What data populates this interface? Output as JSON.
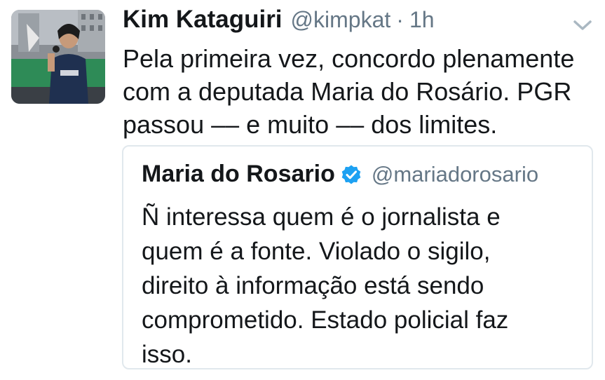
{
  "tweet": {
    "author_name": "Kim Kataguiri",
    "author_handle": "@kimpkat",
    "separator": "·",
    "time": "1h",
    "avatar_icon": "profile-photo",
    "menu_icon": "chevron-down-icon",
    "text_lines": [
      "Pela primeira vez, concordo plenamente",
      "com a deputada Maria do Rosário. PGR",
      "passou –– e muito –– dos limites."
    ]
  },
  "quoted_tweet": {
    "author_name": "Maria do Rosario",
    "verified_icon": "verified-badge-icon",
    "author_handle": "@mariadorosario",
    "text_lines": [
      "Ñ interessa quem é o jornalista e",
      "quem é a fonte. Violado o sigilo,",
      "direito à informação está sendo",
      "comprometido. Estado policial faz",
      "isso."
    ]
  },
  "colors": {
    "text": "#14171a",
    "secondary": "#657786",
    "verified": "#1da1f2",
    "border": "#e1e8ed"
  }
}
